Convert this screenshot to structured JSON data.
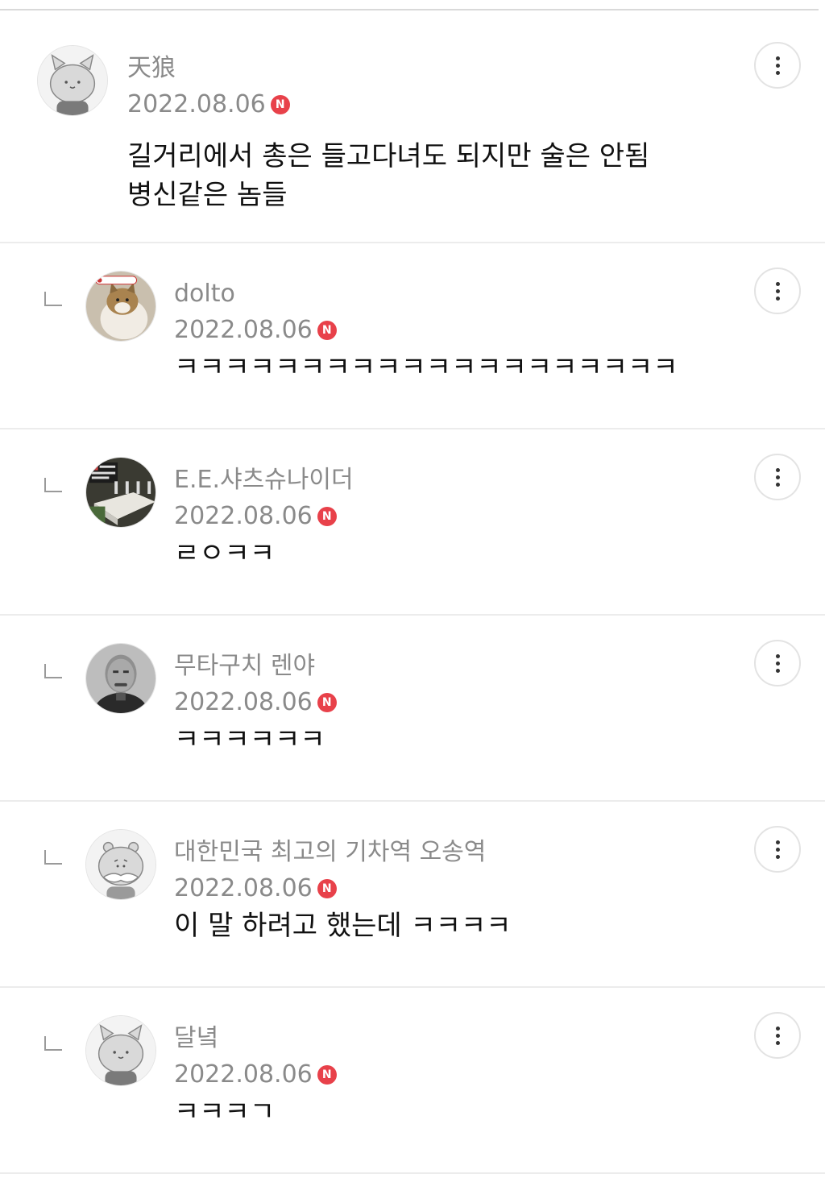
{
  "comments": [
    {
      "author": "天狼",
      "date": "2022.08.06",
      "badge": "N",
      "avatar_icon": "cat-default-avatar-icon",
      "lines": [
        "길거리에서 총은 들고다녀도 되지만 술은 안됨",
        "병신같은 놈들"
      ]
    },
    {
      "author": "dolto",
      "date": "2022.08.06",
      "badge": "N",
      "avatar_icon": "cat-photo-avatar-icon",
      "lines": [
        "ㅋㅋㅋㅋㅋㅋㅋㅋㅋㅋㅋㅋㅋㅋㅋㅋㅋㅋㅋㅋ"
      ]
    },
    {
      "author": "E.E.샤츠슈나이더",
      "date": "2022.08.06",
      "badge": "N",
      "avatar_icon": "photo-avatar-icon",
      "lines": [
        "ㄹㅇㅋㅋ"
      ]
    },
    {
      "author": "무타구치 렌야",
      "date": "2022.08.06",
      "badge": "N",
      "avatar_icon": "portrait-avatar-icon",
      "lines": [
        "ㅋㅋㅋㅋㅋㅋ"
      ]
    },
    {
      "author": "대한민국 최고의 기차역 오송역",
      "date": "2022.08.06",
      "badge": "N",
      "avatar_icon": "mustache-default-avatar-icon",
      "lines": [
        "이 말 하려고 했는데 ㅋㅋㅋㅋ"
      ]
    },
    {
      "author": "달녘",
      "date": "2022.08.06",
      "badge": "N",
      "avatar_icon": "cat-default-avatar-icon",
      "lines": [
        "ㅋㅋㅋㄱ"
      ]
    }
  ],
  "colors": {
    "badge": "#e8414a",
    "meta_text": "#8a8a8a",
    "body_text": "#111111",
    "divider": "#ececec"
  }
}
